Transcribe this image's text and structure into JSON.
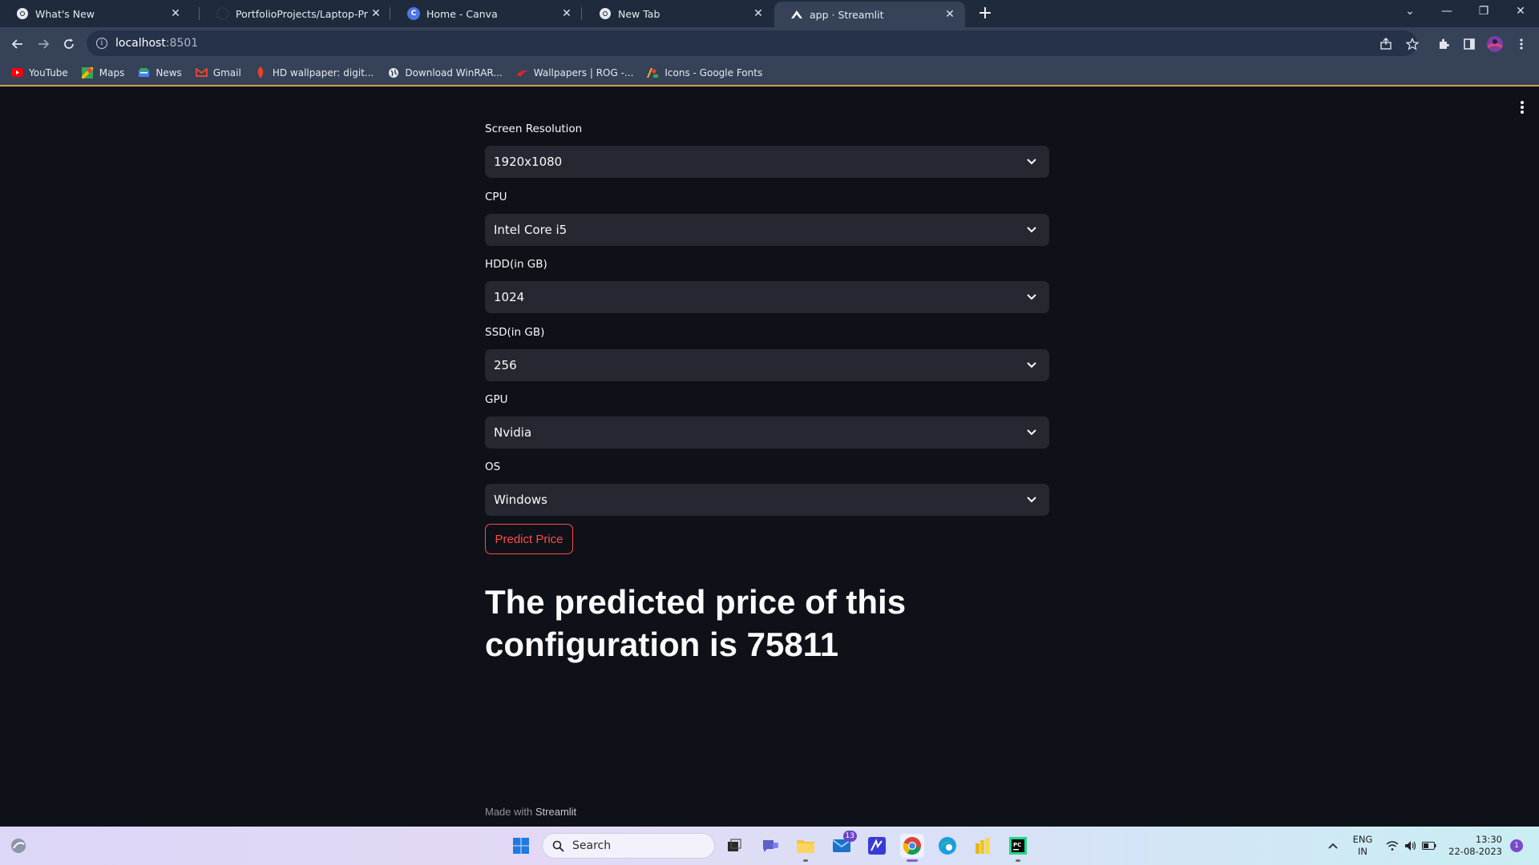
{
  "browser": {
    "tabs": [
      {
        "title": "What's New",
        "active": false
      },
      {
        "title": "PortfolioProjects/Laptop-Price-Pr",
        "active": false
      },
      {
        "title": "Home - Canva",
        "active": false
      },
      {
        "title": "New Tab",
        "active": false
      },
      {
        "title": "app · Streamlit",
        "active": true
      }
    ],
    "address": {
      "host": "localhost",
      "port": ":8501"
    },
    "bookmarks": [
      {
        "label": "YouTube",
        "icon": "youtube-icon"
      },
      {
        "label": "Maps",
        "icon": "maps-icon"
      },
      {
        "label": "News",
        "icon": "news-icon"
      },
      {
        "label": "Gmail",
        "icon": "gmail-icon"
      },
      {
        "label": "HD wallpaper: digit...",
        "icon": "wallpaper-icon"
      },
      {
        "label": "Download WinRAR...",
        "icon": "globe-icon"
      },
      {
        "label": "Wallpapers | ROG -...",
        "icon": "rog-icon"
      },
      {
        "label": "Icons - Google Fonts",
        "icon": "google-fonts-icon"
      }
    ]
  },
  "form": {
    "fields": [
      {
        "label": "Screen Resolution",
        "value": "1920x1080"
      },
      {
        "label": "CPU",
        "value": "Intel Core i5"
      },
      {
        "label": "HDD(in GB)",
        "value": "1024"
      },
      {
        "label": "SSD(in GB)",
        "value": "256"
      },
      {
        "label": "GPU",
        "value": "Nvidia"
      },
      {
        "label": "OS",
        "value": "Windows"
      }
    ],
    "predict_label": "Predict Price"
  },
  "result": {
    "text": "The predicted price of this configuration is 75811"
  },
  "footer": {
    "prefix": "Made with ",
    "brand": "Streamlit"
  },
  "taskbar": {
    "search_placeholder": "Search",
    "mail_badge": "13",
    "lang_top": "ENG",
    "lang_bottom": "IN",
    "time": "13:30",
    "date": "22-08-2023",
    "notification_count": "1"
  },
  "colors": {
    "accent": "#ff4b4b",
    "background": "#0e1117",
    "select_bg": "#262730"
  }
}
